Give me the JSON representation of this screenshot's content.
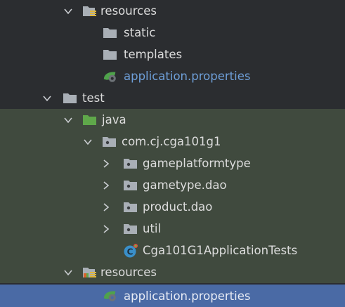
{
  "tree": {
    "rows": [
      {
        "label": "resources",
        "icon": "resources-folder-icon",
        "chevron": "down"
      },
      {
        "label": "static",
        "icon": "folder-icon",
        "chevron": "none"
      },
      {
        "label": "templates",
        "icon": "folder-icon",
        "chevron": "none"
      },
      {
        "label": "application.properties",
        "icon": "spring-properties-icon",
        "chevron": "none"
      },
      {
        "label": "test",
        "icon": "folder-icon",
        "chevron": "down"
      },
      {
        "label": "java",
        "icon": "test-source-folder-icon",
        "chevron": "down"
      },
      {
        "label": "com.cj.cga101g1",
        "icon": "package-icon",
        "chevron": "down"
      },
      {
        "label": "gameplatformtype",
        "icon": "package-icon",
        "chevron": "right"
      },
      {
        "label": "gametype.dao",
        "icon": "package-icon",
        "chevron": "right"
      },
      {
        "label": "product.dao",
        "icon": "package-icon",
        "chevron": "right"
      },
      {
        "label": "util",
        "icon": "package-icon",
        "chevron": "right"
      },
      {
        "label": "Cga101G1ApplicationTests",
        "icon": "test-class-icon",
        "chevron": "none"
      },
      {
        "label": "resources",
        "icon": "test-resources-folder-icon",
        "chevron": "down"
      },
      {
        "label": "application.properties",
        "icon": "spring-properties-icon",
        "chevron": "none"
      }
    ]
  },
  "colors": {
    "background": "#2b2d30",
    "test_section_background": "#404a3e",
    "selection": "#4a6aa5",
    "properties_text": "#6e9fd8",
    "folder": "#a9afb6",
    "test_folder": "#5fa84a"
  }
}
